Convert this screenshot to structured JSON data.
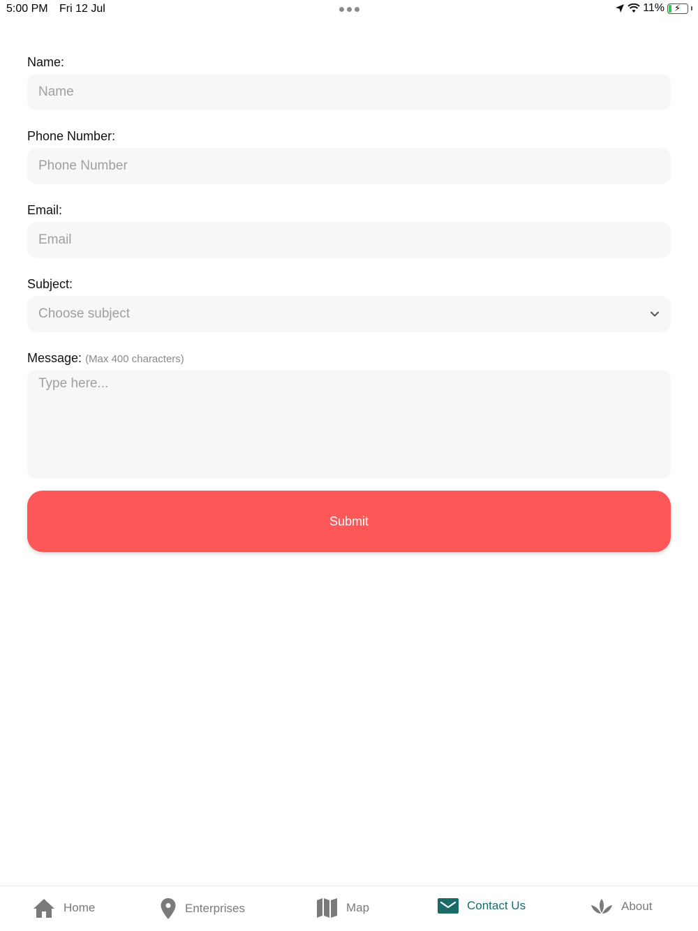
{
  "status_bar": {
    "time": "5:00 PM",
    "date": "Fri 12 Jul",
    "battery": "11%"
  },
  "form": {
    "name": {
      "label": "Name:",
      "placeholder": "Name"
    },
    "phone": {
      "label": "Phone Number:",
      "placeholder": "Phone Number"
    },
    "email": {
      "label": "Email:",
      "placeholder": "Email"
    },
    "subject": {
      "label": "Subject:",
      "placeholder": "Choose subject"
    },
    "message": {
      "label": "Message:",
      "hint": "(Max 400 characters)",
      "placeholder": "Type here..."
    },
    "submit_label": "Submit"
  },
  "tabs": [
    {
      "label": "Home",
      "icon": "home-icon"
    },
    {
      "label": "Enterprises",
      "icon": "map-pin-icon"
    },
    {
      "label": "Map",
      "icon": "map-icon"
    },
    {
      "label": "Contact Us",
      "icon": "envelope-icon",
      "active": true
    },
    {
      "label": "About",
      "icon": "lotus-icon"
    }
  ],
  "colors": {
    "accent": "#fe5757",
    "active_tab": "#1a6b68",
    "inactive_tab": "#7a7a7a",
    "field_bg": "#f7f7f7"
  }
}
